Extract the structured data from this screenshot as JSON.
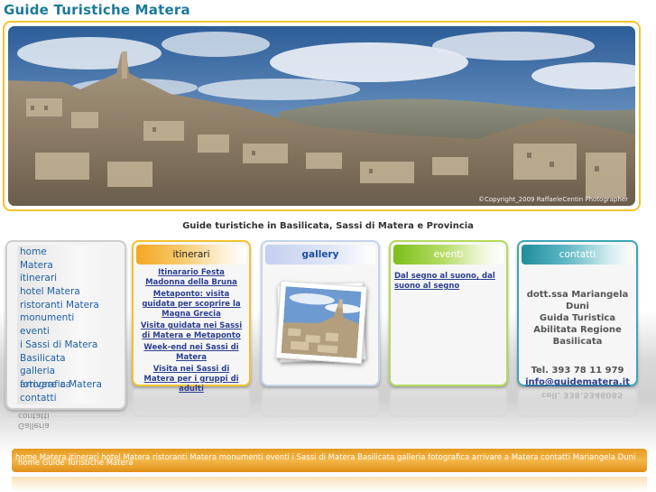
{
  "site": {
    "title": "Guide Turistiche Matera",
    "tagline": "Guide turistiche in Basilicata, Sassi di Matera e Provincia",
    "hero_credit": "©Copyright_2009 RaffaeleCentin Photographer"
  },
  "nav": {
    "items": [
      "home",
      "Matera",
      "itinerari",
      "hotel Matera",
      "ristoranti Matera",
      "monumenti",
      "eventi",
      "i Sassi di Matera",
      "Basilicata",
      "galleria",
      "arrivare a Matera",
      "contatti"
    ],
    "overlay_label": "fotografica",
    "reflection": [
      "contatti",
      "Galleria"
    ]
  },
  "itinerari": {
    "title": "itinerari",
    "links": [
      "Itinarario Festa Madonna della Bruna",
      "Metaponto: visita guidata per scoprire la Magna Grecia",
      "Visita guidata nei Sassi di Matera e Metaponto",
      "Week-end nei Sassi di Matera",
      "Visita nei Sassi di Matera per i gruppi di adulti"
    ]
  },
  "gallery": {
    "title": "gallery"
  },
  "eventi": {
    "title": "eventi",
    "links": [
      "Dal segno al suono, dal suono al segno"
    ]
  },
  "contatti": {
    "title": "contatti",
    "lines": [
      "dott.ssa Mariangela Duni",
      "Guida Turistica",
      "Abilitata Regione",
      "Basilicata"
    ],
    "phone": "Tel. 393 78 11 979",
    "email": "info@guidematera.it",
    "mirror": "cell. 338.5346085"
  },
  "footer": {
    "links": "home Matera itinerari hotel Matera ristoranti Matera monumenti eventi i Sassi di Matera Basilicata galleria fotografica arrivare a Matera contatti Mariangela Duni",
    "home_label": "home Guide Turistiche Matera"
  },
  "colors": {
    "title": "#1c7a98",
    "link": "#2a3f8f",
    "nav_link": "#1e5fa5",
    "itinerari_accent": "#f2c230",
    "gallery_accent": "#c7d3ea",
    "eventi_accent": "#b5d95a",
    "contatti_accent": "#3da6b5",
    "footer": "#f0a830"
  }
}
